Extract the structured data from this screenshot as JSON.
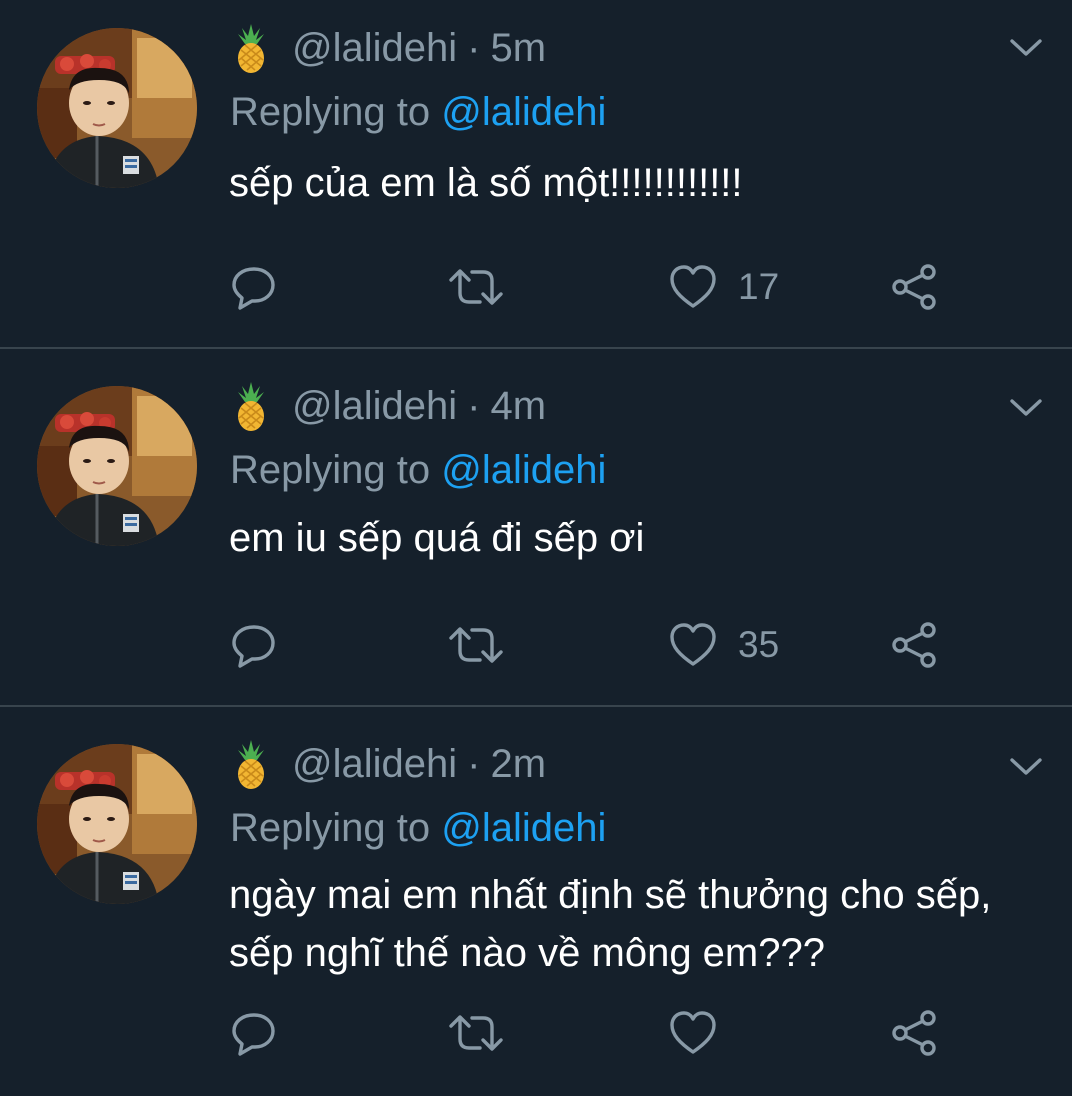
{
  "tweets": [
    {
      "username": "@lalidehi",
      "time": "5m",
      "replying_label": "Replying to",
      "replying_to": "@lalidehi",
      "text": "sếp của em là số một!!!!!!!!!!!!",
      "like_count": "17"
    },
    {
      "username": "@lalidehi",
      "time": "4m",
      "replying_label": "Replying to",
      "replying_to": "@lalidehi",
      "text": "em iu sếp quá đi sếp ơi",
      "like_count": "35"
    },
    {
      "username": "@lalidehi",
      "time": "2m",
      "replying_label": "Replying to",
      "replying_to": "@lalidehi",
      "text": "ngày mai em nhất định sẽ thưởng cho sếp, sếp nghĩ thế nào về mông em???",
      "like_count": ""
    }
  ],
  "separator": "·",
  "icons": {
    "avatar": "avatar-photo",
    "handle_emoji": "pineapple-icon",
    "menu": "chevron-down-icon",
    "reply": "reply-icon",
    "retweet": "retweet-icon",
    "like": "heart-icon",
    "share": "share-icon"
  },
  "colors": {
    "background": "#15202b",
    "secondary_text": "#8899a6",
    "mention": "#1da1f2",
    "divider": "#38444d"
  }
}
